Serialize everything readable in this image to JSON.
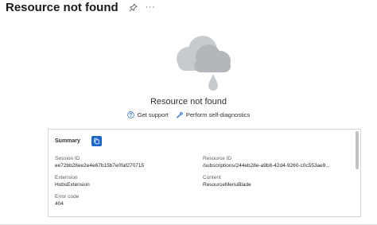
{
  "header": {
    "title": "Resource not found",
    "pin_icon": "pin-icon",
    "more_label": "···"
  },
  "hero": {
    "illustration": "cloud-rain-icon",
    "heading": "Resource not found"
  },
  "actions": [
    {
      "label": "Get support",
      "icon": "help-circle-icon"
    },
    {
      "label": "Perform self-diagnostics",
      "icon": "wrench-icon"
    }
  ],
  "summary": {
    "title": "Summary",
    "copy_icon": "copy-icon",
    "fields": [
      {
        "label": "Session ID",
        "value": "ee72bb28ee2e4e67b15b7e0faf270715"
      },
      {
        "label": "Resource ID",
        "value": "/subscriptions/244eb28e-a9b8-42d4-9260-c0c553ae9..."
      },
      {
        "label": "Extension",
        "value": "HubsExtension"
      },
      {
        "label": "Content",
        "value": "ResourceMenuBlade"
      },
      {
        "label": "Error code",
        "value": "404"
      }
    ]
  },
  "colors": {
    "accent": "#1b65c9",
    "cloud": "#b3b6ba",
    "cloud_light": "#c8cbce"
  }
}
